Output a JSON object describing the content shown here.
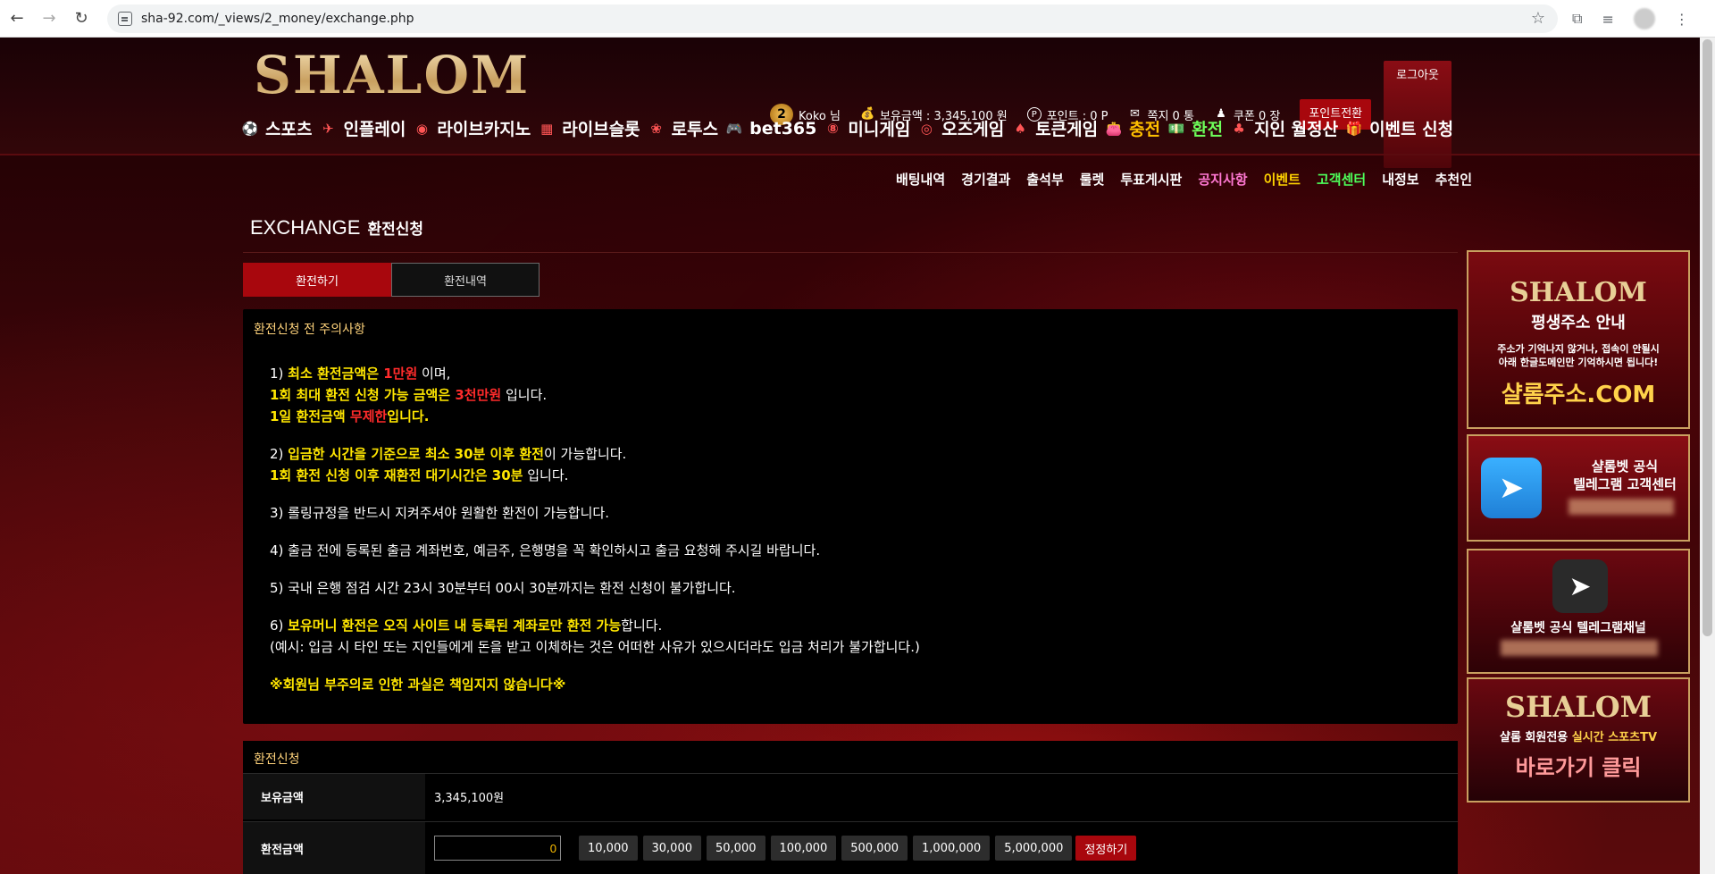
{
  "browser": {
    "url": "sha-92.com/_views/2_money/exchange.php"
  },
  "header": {
    "logo": "SHALOM",
    "user": {
      "level": "2",
      "name": "Koko 님",
      "balance": "보유금액 : 3,345,100 원",
      "points": "포인트 : 0 P",
      "messages": "쪽지 0 통",
      "coupons": "쿠폰 0 장"
    },
    "buttons": {
      "point_convert": "포인트전환",
      "logout": "로그아웃"
    },
    "menu": [
      {
        "label": "스포츠",
        "icon": "soccer-icon"
      },
      {
        "label": "인플레이",
        "icon": "live-icon"
      },
      {
        "label": "라이브카지노",
        "icon": "chip-icon"
      },
      {
        "label": "라이브슬롯",
        "icon": "slot-icon"
      },
      {
        "label": "로투스",
        "icon": "lotus-icon"
      },
      {
        "label": "bet365",
        "icon": "gamepad-icon"
      },
      {
        "label": "미니게임",
        "icon": "ball-icon"
      },
      {
        "label": "오즈게임",
        "icon": "chip-icon"
      },
      {
        "label": "토큰게임",
        "icon": "cards-icon"
      },
      {
        "label": "충전",
        "icon": "wallet-icon"
      },
      {
        "label": "환전",
        "icon": "money-icon"
      },
      {
        "label": "지인 월정산",
        "icon": "people-icon"
      },
      {
        "label": "이벤트 신청",
        "icon": "gift-icon"
      }
    ],
    "submenu": [
      "배팅내역",
      "경기결과",
      "출석부",
      "룰렛",
      "투표게시판",
      "공지사항",
      "이벤트",
      "고객센터",
      "내정보",
      "추천인"
    ]
  },
  "main": {
    "title_en": "EXCHANGE",
    "title_ko": "환전신청",
    "tabs": [
      "환전하기",
      "환전내역"
    ],
    "notice": {
      "title": "환전신청 전 주의사항",
      "l1a_pre": "1) ",
      "l1a_y": "최소 환전금액은 ",
      "l1a_r": "1만원",
      "l1a_post": " 이며,",
      "l1b_y": "1회 최대 환전 신청 가능 금액은 ",
      "l1b_r": "3천만원",
      "l1b_post": " 입니다.",
      "l1c_y": "1일 환전금액 ",
      "l1c_r": "무제한",
      "l1c_y2": "입니다.",
      "l2a_pre": "2) ",
      "l2a_y": "입금한 시간을 기준으로 최소 30분 이후 환전",
      "l2a_post": "이 가능합니다.",
      "l2b_y": "1회 환전 신청 이후 재환전 대기시간은 30분",
      "l2b_post": " 입니다.",
      "l3": "3) 롤링규정을 반드시 지켜주셔야 원활한 환전이 가능합니다.",
      "l4": "4) 출금 전에 등록된 출금 계좌번호, 예금주, 은행명을 꼭 확인하시고 출금 요청해 주시길 바랍니다.",
      "l5": "5) 국내 은행 점검 시간 23시 30분부터 00시 30분까지는 환전 신청이 불가합니다.",
      "l6a_pre": "6) ",
      "l6a_y": "보유머니 환전은 오직 사이트 내 등록된 계좌로만 환전 가능",
      "l6a_post": "합니다.",
      "l6b": "(예시: 입금 시 타인 또는 지인들에게 돈을 받고 이체하는 것은 어떠한 사유가 있으시더라도 입금 처리가 불가합니다.)",
      "warning": "※회원님 부주의로 인한 과실은 책임지지 않습니다※"
    },
    "apply": {
      "title": "환전신청",
      "balance_label": "보유금액",
      "balance_value": "3,345,100원",
      "amount_label": "환전금액",
      "amount_value": "0",
      "quick_amounts": [
        "10,000",
        "30,000",
        "50,000",
        "100,000",
        "500,000",
        "1,000,000",
        "5,000,000"
      ],
      "reset_label": "정정하기"
    }
  },
  "sidebar": {
    "banner1": {
      "logo": "SHALOM",
      "head": "평생주소 안내",
      "sub1": "주소가 기억나지 않거나, 접속이 안될시",
      "sub2": "아래 한글도메인만 기억하시면 됩니다!",
      "url": "샬롬주소.COM"
    },
    "banner2": {
      "line1": "샬롬벳 공식",
      "line2": "텔레그램 고객센터"
    },
    "banner3": {
      "text": "샬롬벳 공식 텔레그램채널"
    },
    "banner4": {
      "logo": "SHALOM",
      "text_pre": "샬롬 회원전용 ",
      "text_gold": "실시간 스포츠TV",
      "click": "바로가기 클릭"
    }
  },
  "colors": {
    "accent_red": "#a8070d",
    "highlight_yellow": "#ffe600",
    "highlight_red": "#ff2b2b",
    "gold": "#c9a060"
  }
}
